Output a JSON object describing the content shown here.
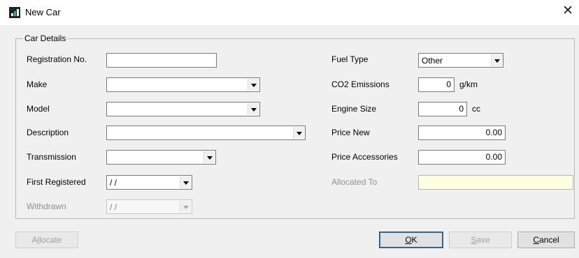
{
  "window": {
    "title": "New Car",
    "close_icon": "✕"
  },
  "group": {
    "legend": "Car Details"
  },
  "left_labels": {
    "registration_no": "Registration No.",
    "make": "Make",
    "model": "Model",
    "description": "Description",
    "transmission": "Transmission",
    "first_registered": "First Registered",
    "withdrawn": "Withdrawn"
  },
  "left_values": {
    "registration_no": "",
    "make": "",
    "model": "",
    "description": "",
    "transmission": "",
    "first_registered": "/ /",
    "withdrawn": "/ /"
  },
  "right_labels": {
    "fuel_type": "Fuel Type",
    "co2_emissions": "CO2 Emissions",
    "engine_size": "Engine Size",
    "price_new": "Price New",
    "price_accessories": "Price Accessories",
    "allocated_to": "Allocated To"
  },
  "right_values": {
    "fuel_type": "Other",
    "co2_emissions": "0",
    "co2_unit": "g/km",
    "engine_size": "0",
    "engine_unit": "cc",
    "price_new": "0.00",
    "price_accessories": "0.00",
    "allocated_to": ""
  },
  "buttons": {
    "allocate": {
      "pre": "A",
      "mn": "l",
      "post": "locate"
    },
    "ok": {
      "pre": "",
      "mn": "O",
      "post": "K"
    },
    "save": {
      "pre": "",
      "mn": "S",
      "post": "ave"
    },
    "cancel": {
      "pre": "",
      "mn": "C",
      "post": "ancel"
    }
  },
  "colors": {
    "window_bg": "#f0f0f0",
    "titlebar_bg": "#ffffff",
    "allocated_field_bg": "#ffffe1",
    "disabled_text": "#8f8f8f"
  }
}
